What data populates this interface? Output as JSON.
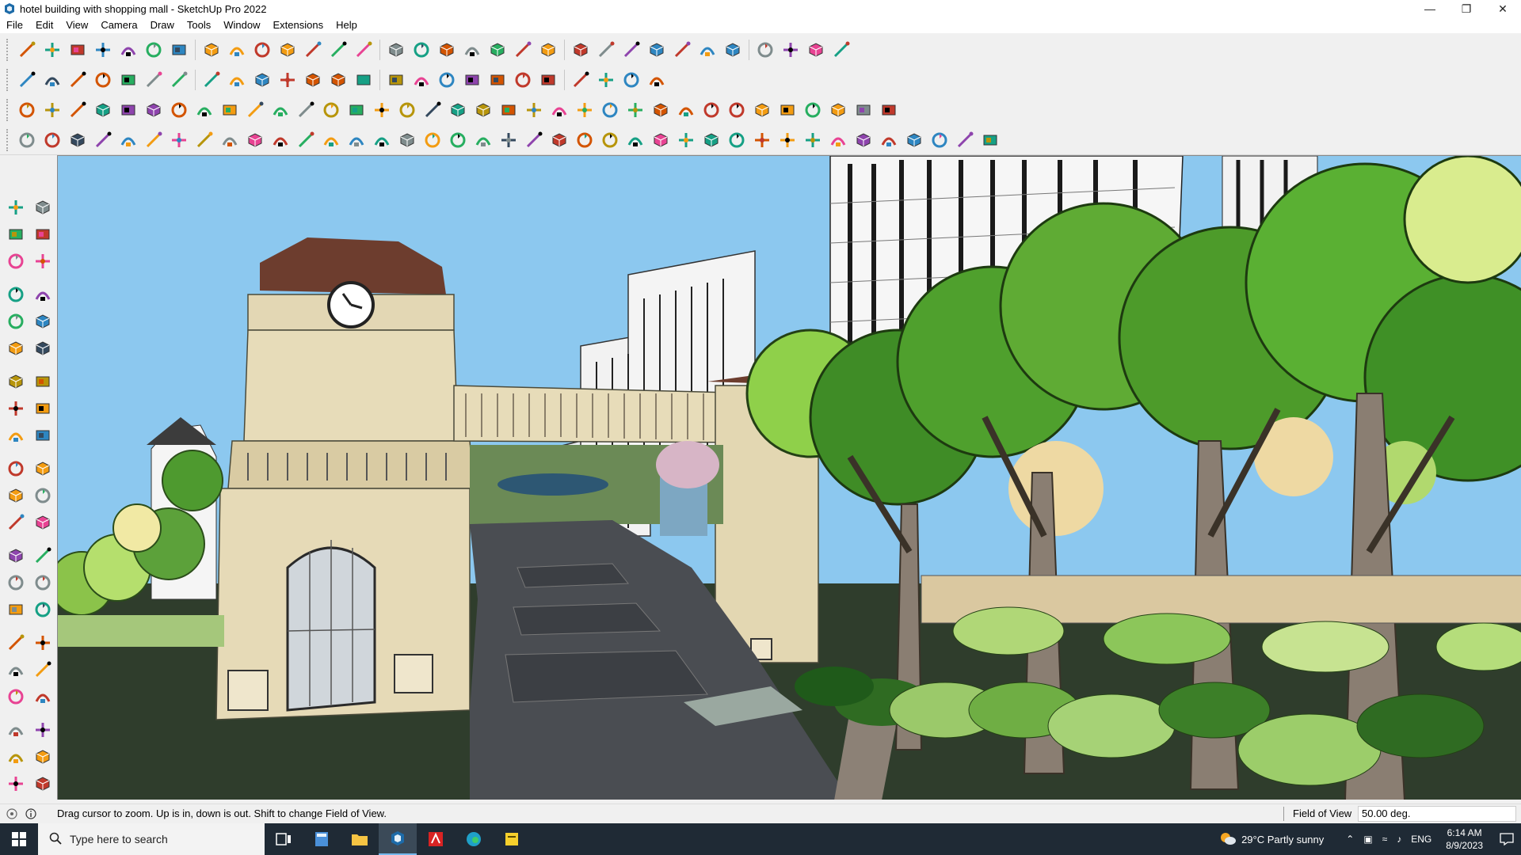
{
  "window": {
    "title": "hotel building with shopping mall - SketchUp Pro 2022",
    "app_icon": "sketchup-icon",
    "controls": [
      "minimize-icon",
      "restore-icon",
      "close-icon"
    ]
  },
  "menu": {
    "items": [
      "File",
      "Edit",
      "View",
      "Camera",
      "Draw",
      "Tools",
      "Window",
      "Extensions",
      "Help"
    ]
  },
  "toolbars": {
    "row1": [
      "zoom-icon",
      "select-icon",
      "eraser-icon",
      "pencil-line-icon",
      "freehand-icon",
      "rectangle-icon",
      "push-pull-icon",
      "follow-me-icon",
      "move-icon",
      "rotate-icon",
      "scale-icon",
      "tape-measure-icon",
      "text-icon",
      "paint-bucket-icon",
      "orbit-icon",
      "pan-icon",
      "zoom-active-icon",
      "zoom-extents-icon",
      "xray-icon",
      "section-icon",
      "layers-icon",
      "styles-icon",
      "profile-icon",
      "warehouse-icon",
      "components-icon",
      "flip-icon",
      "sandbox-icon",
      "stack-icon",
      "axes-icon",
      "undo-icon",
      "redo-icon",
      "extension-icon"
    ],
    "row2": [
      "cube-icon",
      "iso-icon",
      "top-icon",
      "front-icon",
      "right-icon",
      "back-icon",
      "left-icon",
      "bottom-icon",
      "fold-icon",
      "shadow-icon",
      "fog-icon",
      "wall-icon",
      "roof-icon",
      "house-icon",
      "house2-icon",
      "garage-icon",
      "fence-icon",
      "tag-icon",
      "ruler-icon",
      "polygon-icons",
      "trim-icon",
      "pink-eraser-icon",
      "shed-icon",
      "texture-icon",
      "arrow-multi-icon"
    ],
    "row3": [
      "plane-blue-icon",
      "plane-cyan-icon",
      "plane-yellow-icon",
      "plane-green-icon",
      "plane-red-icon",
      "plane-white-icon",
      "curve-icon",
      "square-red-icon",
      "grid-icon",
      "bezier-icon",
      "block-icon",
      "hook-icon",
      "spline-icon",
      "cross-red-icon",
      "cross-green-icon",
      "cross-blue-icon",
      "cone-icon",
      "pyramid-icon",
      "arc-icon",
      "cut-icon",
      "loop-icon",
      "target-icon",
      "cup-icon",
      "red-hook-icon",
      "leaf-icon",
      "misc-icon",
      "component-red-icon",
      "mesh-icon",
      "frame-icon",
      "tile-icon",
      "tile2-icon",
      "tile3-icon",
      "scatter-icon",
      "dashes-icon",
      "grid2-icon"
    ],
    "row4": [
      "vector-icon",
      "curve2-icon",
      "car-icon",
      "scissors-icon",
      "gear-icon",
      "shoe-icon",
      "pipe-icon",
      "book-icon",
      "sphere-icon",
      "bevel-icon",
      "corner-icon",
      "angle-icon",
      "knife-icon",
      "bend-icon",
      "chair-icon",
      "wedge-icon",
      "columns-icon",
      "stair-icon",
      "hand-icon",
      "leaf2-icon",
      "arrow-left-icon",
      "stack2-icon",
      "pen-icon",
      "path-icon",
      "path2-icon",
      "path3-icon",
      "ship-icon",
      "box3d-icon",
      "bend2-icon",
      "wall2-icon",
      "hatch-icon",
      "hatch2-icon",
      "hatch3-icon",
      "bars-icon",
      "gear2-icon",
      "gear3-icon",
      "slope-icon",
      "wave-icon",
      "cube-outline-icon"
    ]
  },
  "left_toolbar": [
    "select-icon",
    "orbit-icon",
    "paint-icon",
    "eraser-icon",
    "component-icon",
    "tape-icon",
    "pencil-icon",
    "freehand-icon",
    "rectangle-icon",
    "rotated-rect-icon",
    "circle-icon",
    "polygon-icon",
    "arc-icon",
    "arc2-icon",
    "pie-icon",
    "pie2-icon",
    "move-icon",
    "push-pull-icon",
    "rotate-icon",
    "follow-me-icon",
    "scale-icon",
    "offset-icon",
    "tape-measure-icon",
    "dimension-icon",
    "protractor-icon",
    "text-icon",
    "axes-icon",
    "3d-text-icon",
    "orbit2-icon",
    "pan-icon",
    "zoom-icon",
    "zoom-window-icon",
    "zoom-extents-icon",
    "previous-icon",
    "position-camera-icon",
    "look-around-icon",
    "walk-icon",
    "section-plane-icon",
    "model-icon",
    "layers-icon",
    "outliner-icon",
    "styles-icon"
  ],
  "status": {
    "hint": "Drag cursor to zoom.  Up is in, down is out. Shift to change Field of View.",
    "fov_label": "Field of View",
    "fov_value": "50.00 deg."
  },
  "taskbar": {
    "search_placeholder": "Type here to search",
    "apps": [
      "task-view-icon",
      "calculator-icon",
      "file-explorer-icon",
      "sketchup-taskbar-icon",
      "acrobat-icon",
      "edge-icon",
      "sticky-notes-icon"
    ],
    "weather": "29°C  Partly sunny",
    "lang": "ENG",
    "time": "6:14 AM",
    "date": "8/9/2023"
  },
  "colors": {
    "sky": "#8cc8ef",
    "ground_dark": "#2f3d2c",
    "road": "#4a4d52",
    "tree_green": "#4f9b2c",
    "tree_light": "#9bd267",
    "stone": "#e1d4b1",
    "taskbar": "#1f2a35"
  }
}
